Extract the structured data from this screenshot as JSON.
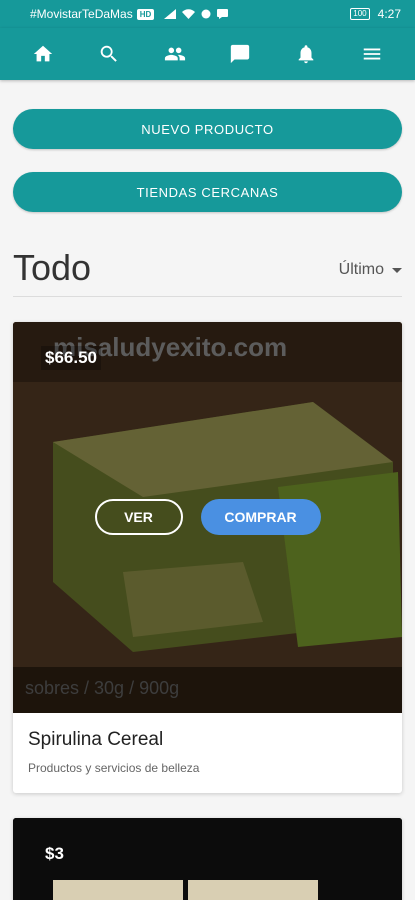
{
  "status_bar": {
    "carrier": "#MovistarTeDaMas",
    "hd_badge": "HD",
    "battery": "100",
    "time": "4:27"
  },
  "nav": {
    "icons": [
      "home-icon",
      "search-icon",
      "people-icon",
      "chat-icon",
      "bell-icon",
      "menu-icon"
    ]
  },
  "actions": {
    "new_product": "NUEVO PRODUCTO",
    "nearby_stores": "TIENDAS CERCANAS"
  },
  "section": {
    "title": "Todo",
    "sort_label": "Último"
  },
  "products": [
    {
      "price": "$66.50",
      "view_label": "VER",
      "buy_label": "COMPRAR",
      "name": "Spirulina Cereal",
      "category": "Productos y servicios de belleza",
      "image_text_top": "misaludyexito.com",
      "image_text_bottom": "sobres / 30g / 900g"
    },
    {
      "price": "$3"
    }
  ],
  "colors": {
    "primary": "#16999a",
    "buy_button": "#4a90e2",
    "background": "#f5f5f5"
  }
}
